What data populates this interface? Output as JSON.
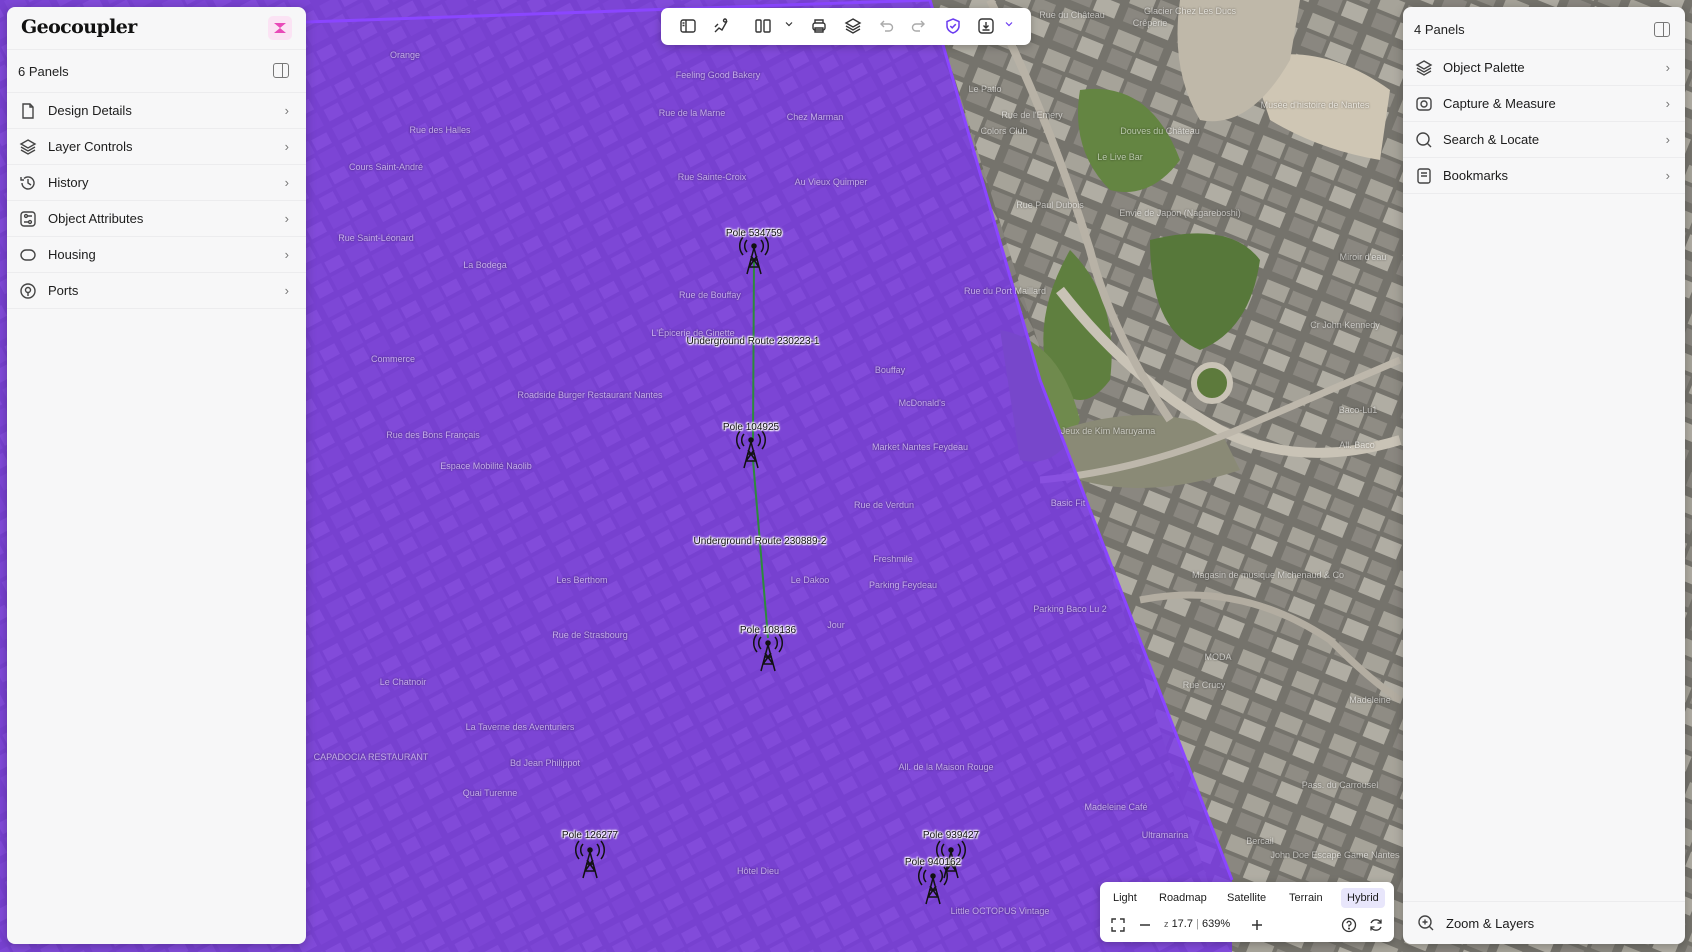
{
  "app": {
    "brand": "Geocoupler"
  },
  "left_panel": {
    "count_label": "6 Panels",
    "items": [
      {
        "label": "Design Details",
        "icon": "document-icon"
      },
      {
        "label": "Layer Controls",
        "icon": "layers-icon"
      },
      {
        "label": "History",
        "icon": "history-icon"
      },
      {
        "label": "Object Attributes",
        "icon": "sliders-icon"
      },
      {
        "label": "Housing",
        "icon": "housing-icon"
      },
      {
        "label": "Ports",
        "icon": "port-icon"
      }
    ]
  },
  "right_panel": {
    "count_label": "4 Panels",
    "items": [
      {
        "label": "Object Palette",
        "icon": "palette-icon"
      },
      {
        "label": "Capture & Measure",
        "icon": "capture-icon"
      },
      {
        "label": "Search & Locate",
        "icon": "search-icon"
      },
      {
        "label": "Bookmarks",
        "icon": "bookmark-icon"
      }
    ],
    "footer_label": "Zoom & Layers"
  },
  "toolbar": {
    "buttons": [
      "panel-icon",
      "draw-icon",
      "split-view-icon",
      "print-icon",
      "layers-icon",
      "undo-icon",
      "redo-icon",
      "shield-icon",
      "export-icon"
    ]
  },
  "map_controls": {
    "styles": [
      "Light",
      "Roadmap",
      "Satellite",
      "Terrain",
      "Hybrid"
    ],
    "active_style": "Hybrid",
    "zoom_prefix": "z",
    "zoom_level": "17.7",
    "zoom_percent": "639%"
  },
  "map_objects": {
    "poles": [
      "Pole 534759",
      "Pole 104925",
      "Pole 108136",
      "Pole 126277",
      "Pole 939427",
      "Pole 940162"
    ],
    "routes": [
      "Underground Route 230223-1",
      "Underground Route 230889-2"
    ]
  },
  "map_places": [
    "Rue du Château",
    "Glacier Chez Les Ducs",
    "Crêperie",
    "Le Patio",
    "Rue de l'Emery",
    "Colors Club",
    "Douves du Château",
    "Musée d'histoire de Nantes",
    "Le Live Bar",
    "Envie de Japon (Nagareboshi)",
    "Miroir d'eau",
    "Cr John Kennedy",
    "Baco-Lu1",
    "All. Baco",
    "Jeux de Kim Maruyama",
    "Magasin de musique Michenaud & Co",
    "MODA",
    "Rue Crucy",
    "Madeleine Café",
    "Ultramarina",
    "Bercail",
    "John Doe Escape Game Nantes",
    "Feeling Good Bakery",
    "Rue de la Marne",
    "Chez Marman",
    "Au Vieux Quimper",
    "Rue Sainte-Croix",
    "La Bodega",
    "L'Épicerie de Ginette",
    "Roadside Burger Restaurant Nantes",
    "McDonald's",
    "Market Nantes Feydeau",
    "Espace Mobilité Naolib",
    "Rue des Bons Français",
    "Commerce",
    "Les Berthom",
    "Freshmile",
    "Parking Feydeau",
    "Parking Baco Lu 2",
    "Le Chatnoir",
    "La Taverne des Aventuriers",
    "CAPADOCIA RESTAURANT",
    "Bd Jean Philippot",
    "All. de la Maison Rouge",
    "Little OCTOPUS Vintage",
    "Hôtel Dieu",
    "Orange",
    "Rue de Bouffay",
    "Rue des Halles",
    "Rue Saint-Léonard",
    "Rue de Verdun",
    "Quai Turenne",
    "Rue de Strasbourg",
    "Bouffay",
    "Rue Paul Dubois",
    "Pass. du Carrousel",
    "Madeleine",
    "Cours Saint-André",
    "Basic Fit",
    "Rue du Port Maillard",
    "Le Dakoo",
    "Jour"
  ]
}
